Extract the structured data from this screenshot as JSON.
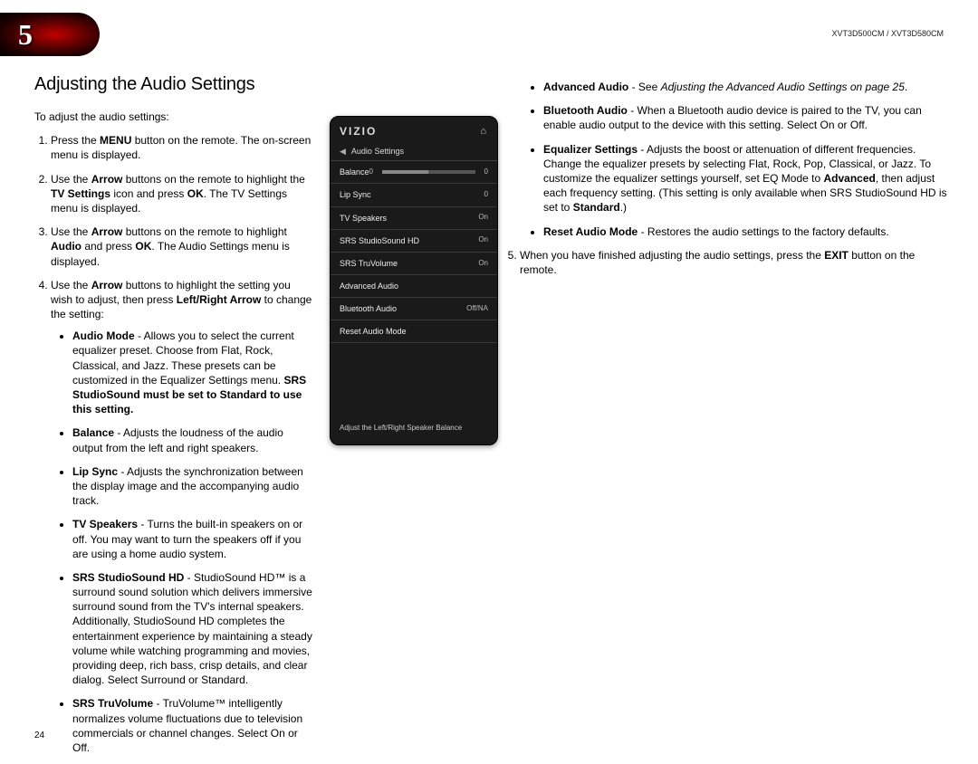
{
  "chapter": "5",
  "model_label": "XVT3D500CM / XVT3D580CM",
  "page_number": "24",
  "heading": "Adjusting the Audio Settings",
  "intro": "To adjust the audio settings:",
  "steps": {
    "s1_a": "Press the ",
    "s1_b": "MENU",
    "s1_c": " button on the remote. The on-screen menu is displayed.",
    "s2_a": "Use the ",
    "s2_b": "Arrow",
    "s2_c": " buttons on the remote to highlight the ",
    "s2_d": "TV Settings",
    "s2_e": " icon and press ",
    "s2_f": "OK",
    "s2_g": ". The TV Settings menu is displayed.",
    "s3_a": "Use the ",
    "s3_b": "Arrow",
    "s3_c": " buttons on the remote to highlight ",
    "s3_d": "Audio",
    "s3_e": " and press ",
    "s3_f": "OK",
    "s3_g": ". The Audio Settings menu is displayed.",
    "s4_a": "Use the ",
    "s4_b": "Arrow",
    "s4_c": " buttons to highlight the setting you wish to adjust, then press ",
    "s4_d": "Left/Right Arrow",
    "s4_e": " to change the setting:"
  },
  "bullets_left": {
    "am_t": "Audio Mode",
    "am_a": " - Allows you to select the current equalizer preset. Choose from Flat, Rock, Classical, and Jazz. These presets can be customized in the Equalizer Settings menu. ",
    "am_b": "SRS StudioSound must be set to Standard to use this setting.",
    "bal_t": "Balance",
    "bal_a": " - Adjusts the loudness of the audio output from the left and right speakers.",
    "lip_t": "Lip Sync",
    "lip_a": " - Adjusts the synchronization between the display image and the accompanying audio track.",
    "tvs_t": "TV Speakers",
    "tvs_a": " - Turns the built-in speakers on or off. You may want to turn the speakers off if you are using a home audio system.",
    "ssh_t": "SRS StudioSound HD",
    "ssh_a": " - StudioSound HD™ is a surround sound solution which delivers immersive surround sound from the TV's internal speakers. Additionally, StudioSound HD completes the entertainment experience by maintaining a steady volume while watching programming and movies, providing deep, rich bass, crisp details, and clear dialog. Select Surround or Standard.",
    "tru_t": "SRS TruVolume",
    "tru_a": " - TruVolume™ intelligently normalizes volume fluctuations due to television commercials or channel changes. Select On or Off."
  },
  "bullets_right": {
    "adv_t": "Advanced Audio",
    "adv_a": " - See ",
    "adv_b": "Adjusting the Advanced Audio Settings on page 25",
    "adv_c": ".",
    "bt_t": "Bluetooth Audio",
    "bt_a": " - When a Bluetooth audio device is paired to the TV, you can enable audio output to the device with this setting. Select On or Off.",
    "eq_t": "Equalizer Settings",
    "eq_a": " - Adjusts the boost or attenuation of different frequencies. Change the equalizer presets by selecting Flat, Rock, Pop, Classical, or Jazz. To customize the equalizer settings yourself, set EQ Mode to ",
    "eq_b": "Advanced",
    "eq_c": ", then adjust each frequency setting. (This setting is only available when SRS StudioSound HD is set to ",
    "eq_d": "Standard",
    "eq_e": ".)",
    "rst_t": "Reset Audio Mode",
    "rst_a": " - Restores the audio settings to the factory defaults."
  },
  "step5_a": "When you have finished adjusting the audio settings, press the ",
  "step5_b": "EXIT",
  "step5_c": " button on the remote.",
  "tv": {
    "brand": "VIZIO",
    "title": "Audio Settings",
    "rows": {
      "balance": "Balance",
      "balance_v0": "0",
      "balance_v1": "0",
      "lipsync": "Lip Sync",
      "lipsync_v": "0",
      "tvspk": "TV Speakers",
      "tvspk_v": "On",
      "ssh": "SRS StudioSound HD",
      "ssh_v": "On",
      "tru": "SRS TruVolume",
      "tru_v": "On",
      "adv": "Advanced Audio",
      "bt": "Bluetooth Audio",
      "bt_v": "Off/NA",
      "reset": "Reset Audio Mode"
    },
    "hint": "Adjust the Left/Right Speaker Balance"
  }
}
